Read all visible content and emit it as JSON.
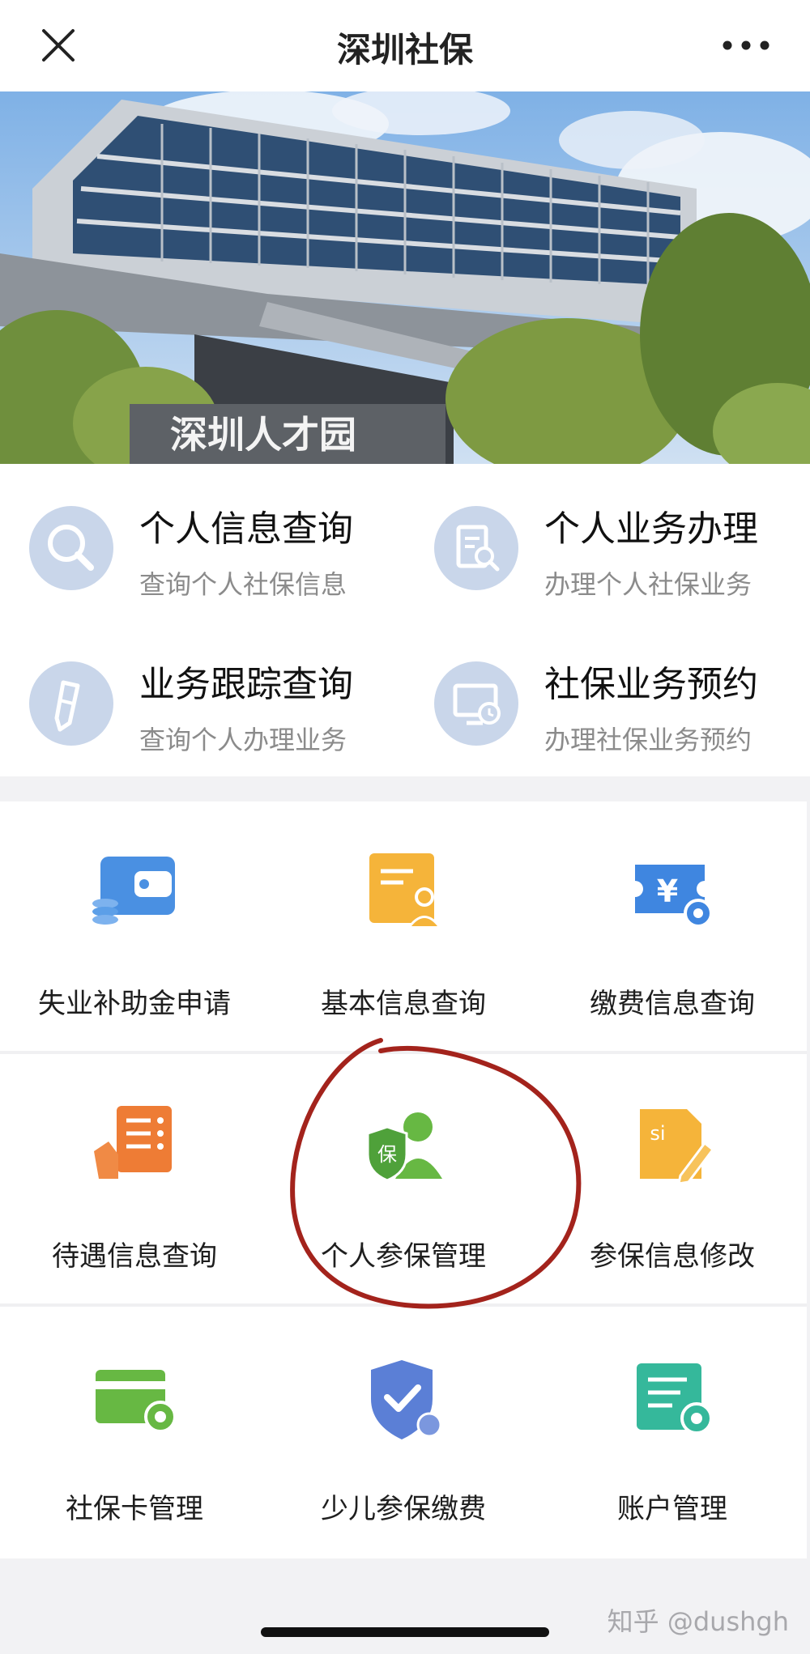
{
  "header": {
    "title": "深圳社保",
    "close_icon": "close-icon",
    "more_icon": "more-dots-icon"
  },
  "banner": {
    "sign_text": "深圳人才园"
  },
  "quick_services": [
    {
      "title": "个人信息查询",
      "subtitle": "查询个人社保信息",
      "icon": "search-icon"
    },
    {
      "title": "个人业务办理",
      "subtitle": "办理个人社保业务",
      "icon": "document-search-icon"
    },
    {
      "title": "业务跟踪查询",
      "subtitle": "查询个人办理业务",
      "icon": "pencil-icon"
    },
    {
      "title": "社保业务预约",
      "subtitle": "办理社保业务预约",
      "icon": "monitor-clock-icon"
    }
  ],
  "services": [
    {
      "label": "失业补助金申请",
      "icon": "wallet-coins-icon",
      "color": "#4a90e2"
    },
    {
      "label": "基本信息查询",
      "icon": "profile-card-icon",
      "color": "#f5b43a"
    },
    {
      "label": "缴费信息查询",
      "icon": "yuan-ticket-icon",
      "color": "#3f86e0"
    },
    {
      "label": "待遇信息查询",
      "icon": "checklist-hand-icon",
      "color": "#ee7c35"
    },
    {
      "label": "个人参保管理",
      "icon": "insured-person-icon",
      "color": "#67b843"
    },
    {
      "label": "参保信息修改",
      "icon": "si-document-edit-icon",
      "color": "#f5b43a"
    },
    {
      "label": "社保卡管理",
      "icon": "card-gear-icon",
      "color": "#67b843"
    },
    {
      "label": "少儿参保缴费",
      "icon": "shield-check-icon",
      "color": "#5b7fd6"
    },
    {
      "label": "账户管理",
      "icon": "ledger-gear-icon",
      "color": "#35b89b"
    }
  ],
  "watermark": "知乎 @dushgh",
  "colors": {
    "icon_circle": "#c9d6ea",
    "annotation": "#a3231c"
  }
}
